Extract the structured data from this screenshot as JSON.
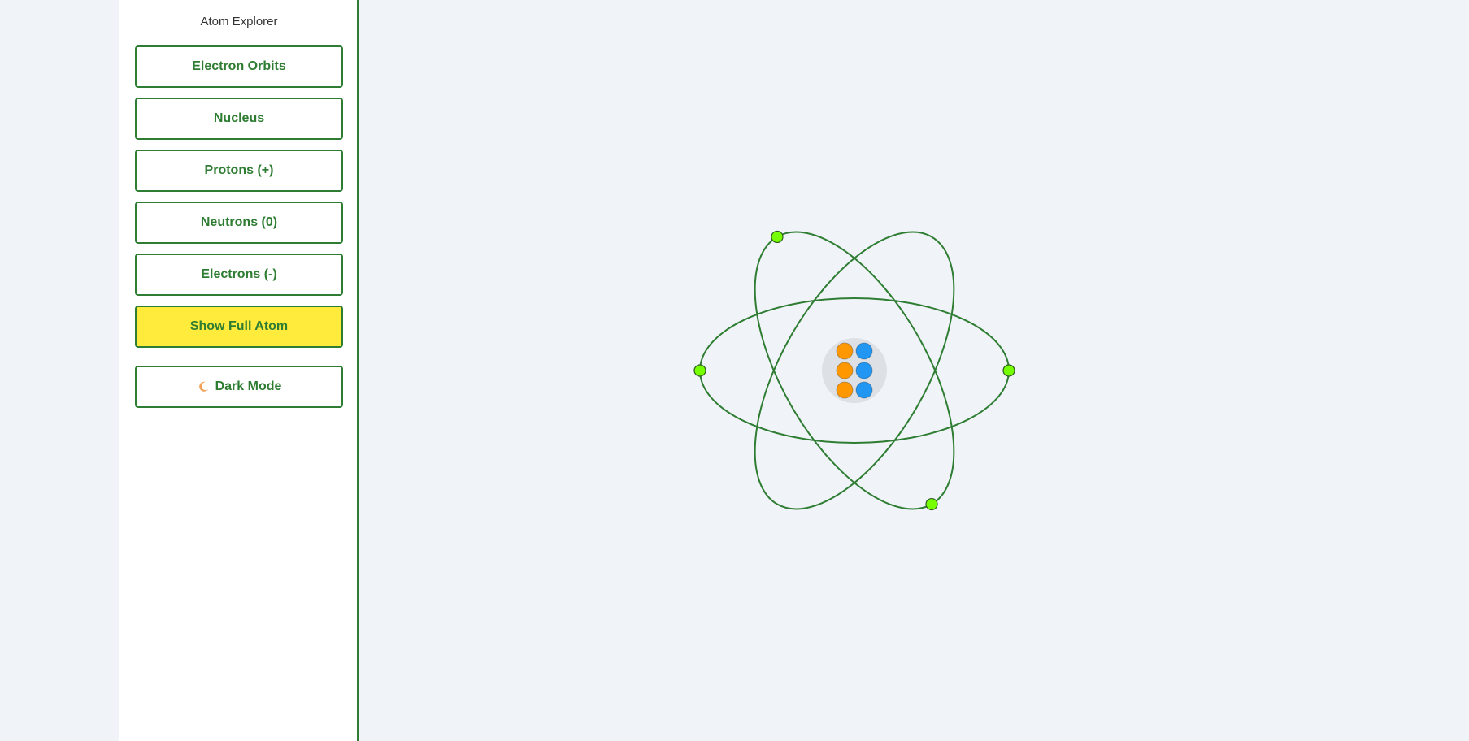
{
  "app": {
    "title": "Atom Explorer"
  },
  "sidebar": {
    "buttons": [
      {
        "label": "Electron Orbits",
        "active": false
      },
      {
        "label": "Nucleus",
        "active": false
      },
      {
        "label": "Protons (+)",
        "active": false
      },
      {
        "label": "Neutrons (0)",
        "active": false
      },
      {
        "label": "Electrons (-)",
        "active": false
      },
      {
        "label": "Show Full Atom",
        "active": true
      }
    ],
    "dark_mode": {
      "label": "Dark Mode",
      "icon": "moon-icon"
    }
  },
  "atom": {
    "protons": 3,
    "neutrons": 3,
    "electrons": 4,
    "orbits": 3,
    "colors": {
      "orbit": "#2e7d32",
      "proton": "#ff9800",
      "neutron": "#2196f3",
      "electron": "#76ff03",
      "nucleus_bg": "#dde1e6",
      "accent": "#2e7d32",
      "active_button": "#ffeb3b"
    }
  }
}
